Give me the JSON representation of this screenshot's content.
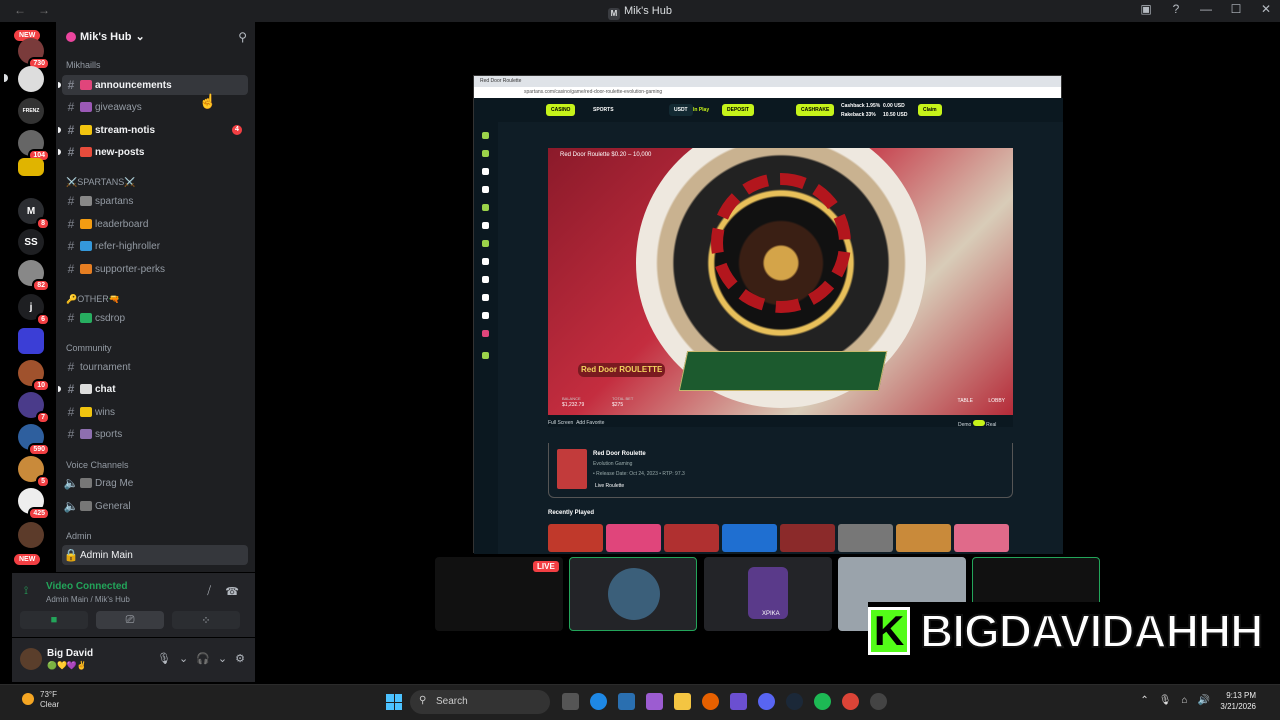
{
  "window": {
    "title": "Mik's Hub",
    "back": "←",
    "forward": "→"
  },
  "server_rail": [
    {
      "label": "NEW",
      "badge": "730"
    },
    {
      "label": "",
      "badge": ""
    },
    {
      "label": "",
      "badge": "104"
    },
    {
      "label": "",
      "badge": ""
    },
    {
      "label": "M",
      "badge": "8"
    },
    {
      "label": "SS",
      "badge": ""
    },
    {
      "label": "",
      "badge": "82"
    },
    {
      "label": "j",
      "badge": "6"
    },
    {
      "label": "",
      "badge": ""
    },
    {
      "label": "",
      "badge": "10"
    },
    {
      "label": "",
      "badge": "7"
    },
    {
      "label": "",
      "badge": "590"
    },
    {
      "label": "",
      "badge": "5"
    },
    {
      "label": "",
      "badge": "425"
    },
    {
      "label": "NEW",
      "badge": ""
    }
  ],
  "sidebar": {
    "server_name": "Mik's Hub",
    "categories": {
      "mikhaills": "Mikhaills",
      "spartans": "⚔️SPARTANS⚔️",
      "other": "🔑OTHER🔫",
      "community": "Community",
      "voice": "Voice Channels",
      "admin": "Admin"
    },
    "channels": {
      "announcements": "announcements",
      "giveaways": "giveaways",
      "stream_notis": "stream-notis",
      "stream_notis_count": "4",
      "new_posts": "new-posts",
      "spartans": "spartans",
      "leaderboard": "leaderboard",
      "refer_highroller": "refer-highroller",
      "supporter_perks": "supporter-perks",
      "csdrop": "csdrop",
      "tournament": "tournament",
      "chat": "chat",
      "wins": "wins",
      "sports": "sports",
      "drag_me": "Drag Me",
      "general": "General",
      "admin_main": "Admin Main"
    }
  },
  "voice_panel": {
    "status": "Video Connected",
    "location": "Admin Main / Mik's Hub"
  },
  "user_panel": {
    "name": "Big David",
    "status": "🟢💛💜✌️"
  },
  "stream": {
    "tab_title": "Red Door Roulette",
    "address": "spartans.com/casino/game/red-door-roulette-evolution-gaming",
    "nav": {
      "casino": "CASINO",
      "sports": "SPORTS",
      "currency": "USDT",
      "inplay": "In Play",
      "deposit": "DEPOSIT",
      "cashrake": "CASHRAKE",
      "claim": "Claim",
      "cashback": "Cashback 1.95%",
      "rakeback": "Rakeback 33%",
      "cb_val": "0.00 USD",
      "rb_val": "10.50 USD"
    },
    "game_title": "Red Door Roulette  $0.20 – 10,000",
    "logo_text": "Red Door ROULETTE",
    "balance_label": "BALANCE",
    "balance": "$1,232.79",
    "total_bet_label": "TOTAL BET",
    "total_bet": "$275",
    "full_screen": "Full Screen",
    "add_favorite": "Add Favorite",
    "demo": "Demo",
    "real": "Real",
    "game_name": "Red Door Roulette",
    "provider": "Evolution Gaming",
    "release": "• Release Date: Oct 24, 2023  • RTP: 97.3",
    "live_roulette": "Live Roulette",
    "recently_played": "Recently Played",
    "table_btn": "TABLE",
    "lobby_btn": "LOBBY"
  },
  "participants": {
    "live": "LIVE",
    "xpika": "XPIKA"
  },
  "overlay": {
    "name": "BIGDAVIDAHHH"
  },
  "taskbar": {
    "temp": "73°F",
    "weather": "Clear",
    "search": "Search",
    "time": "9:13 PM",
    "date": "3/21/2026"
  }
}
